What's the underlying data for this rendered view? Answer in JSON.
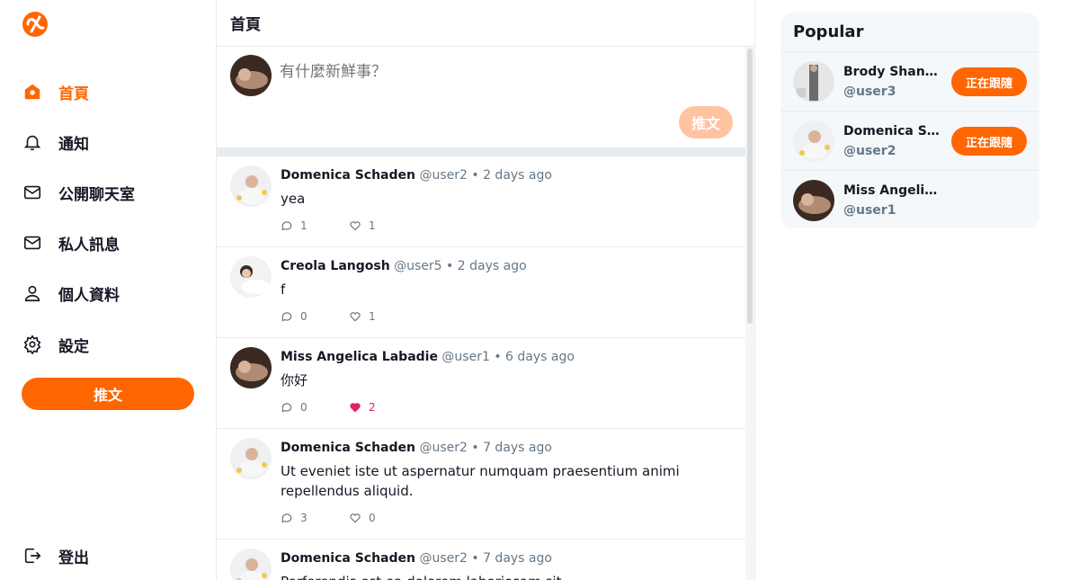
{
  "colors": {
    "brand": "#FF6600",
    "brand_light": "#FFC3A0",
    "like": "#E0245E",
    "muted": "#657786"
  },
  "nav": {
    "items": [
      {
        "label": "首頁",
        "icon": "home-icon",
        "active": true
      },
      {
        "label": "通知",
        "icon": "bell-icon"
      },
      {
        "label": "公開聊天室",
        "icon": "mail-icon"
      },
      {
        "label": "私人訊息",
        "icon": "mail-icon"
      },
      {
        "label": "個人資料",
        "icon": "user-icon"
      },
      {
        "label": "設定",
        "icon": "gear-icon"
      }
    ],
    "tweet_button": "推文",
    "logout": "登出"
  },
  "main": {
    "title": "首頁",
    "compose": {
      "placeholder": "有什麼新鮮事？",
      "button": "推文"
    },
    "tweets": [
      {
        "name": "Domenica Schaden",
        "handle": "@user2",
        "time": "2 days ago",
        "text": "yea",
        "replies": "1",
        "likes": "1",
        "liked": false
      },
      {
        "name": "Creola Langosh",
        "handle": "@user5",
        "time": "2 days ago",
        "text": "f",
        "replies": "0",
        "likes": "1",
        "liked": false
      },
      {
        "name": "Miss Angelica Labadie",
        "handle": "@user1",
        "time": "6 days ago",
        "text": "你好",
        "replies": "0",
        "likes": "2",
        "liked": true
      },
      {
        "name": "Domenica Schaden",
        "handle": "@user2",
        "time": "7 days ago",
        "text": "Ut eveniet iste ut aspernatur numquam praesentium animi repellendus aliquid.",
        "replies": "3",
        "likes": "0",
        "liked": false
      },
      {
        "name": "Domenica Schaden",
        "handle": "@user2",
        "time": "7 days ago",
        "text": "Perferendis est ea dolorem laboriosam sit.",
        "replies": "",
        "likes": "",
        "liked": false
      }
    ],
    "separator": "•"
  },
  "popular": {
    "title": "Popular",
    "users": [
      {
        "name": "Brody Shana...",
        "handle": "@user3",
        "button": "正在跟隨"
      },
      {
        "name": "Domenica Sc...",
        "handle": "@user2",
        "button": "正在跟隨"
      },
      {
        "name": "Miss Angelica...",
        "handle": "@user1",
        "button": ""
      }
    ]
  }
}
